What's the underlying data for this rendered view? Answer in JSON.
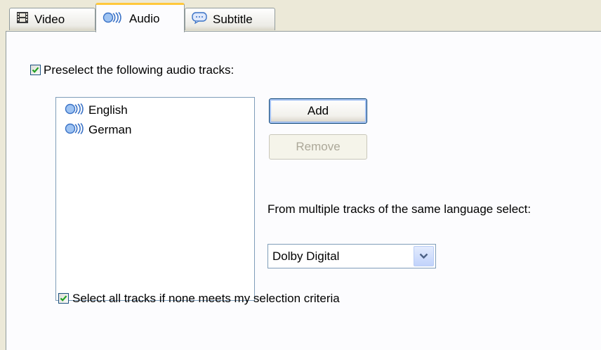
{
  "tabs": [
    {
      "label": "Video",
      "icon": "film-icon",
      "active": false
    },
    {
      "label": "Audio",
      "icon": "audio-icon",
      "active": true
    },
    {
      "label": "Subtitle",
      "icon": "subtitle-icon",
      "active": false
    }
  ],
  "audio": {
    "preselect_label": "Preselect the following audio tracks:",
    "preselect_checked": true,
    "tracks": [
      {
        "label": "English",
        "icon": "audio-icon"
      },
      {
        "label": "German",
        "icon": "audio-icon"
      }
    ],
    "add_label": "Add",
    "remove_label": "Remove",
    "remove_enabled": false,
    "multiple_caption": "From multiple tracks of the same language select:",
    "format_selected": "Dolby Digital",
    "select_all_label": "Select all tracks if none meets my selection criteria",
    "select_all_checked": true
  },
  "colors": {
    "background": "#ece9d8",
    "panel": "#fcfcfe",
    "active_tab_accent": "#ffc83c",
    "checkmark": "#21a121"
  }
}
